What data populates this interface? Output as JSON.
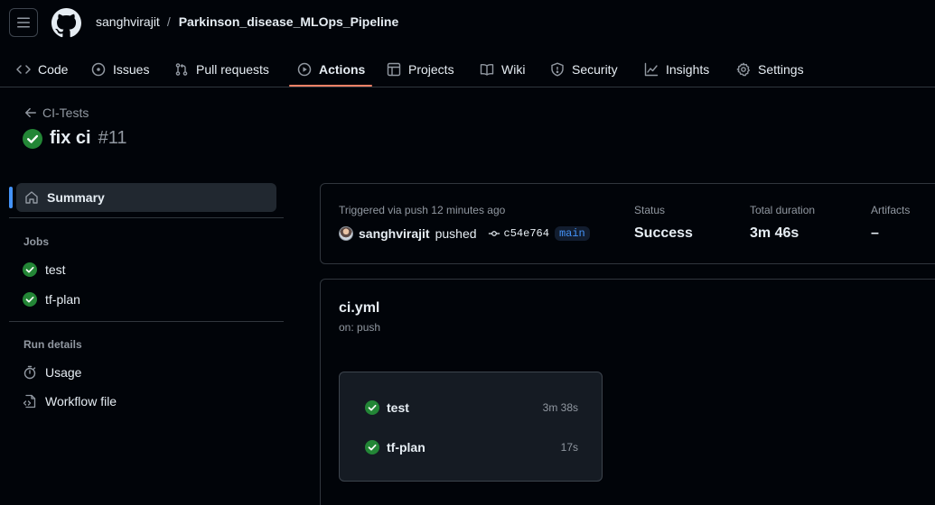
{
  "header": {
    "owner": "sanghvirajit",
    "separator": "/",
    "repo": "Parkinson_disease_MLOps_Pipeline"
  },
  "tabs": [
    {
      "label": "Code",
      "icon": "code-icon"
    },
    {
      "label": "Issues",
      "icon": "issue-icon"
    },
    {
      "label": "Pull requests",
      "icon": "pull-request-icon"
    },
    {
      "label": "Actions",
      "icon": "play-icon",
      "active": true
    },
    {
      "label": "Projects",
      "icon": "table-icon"
    },
    {
      "label": "Wiki",
      "icon": "book-icon"
    },
    {
      "label": "Security",
      "icon": "shield-icon"
    },
    {
      "label": "Insights",
      "icon": "graph-icon"
    },
    {
      "label": "Settings",
      "icon": "gear-icon"
    }
  ],
  "run": {
    "back_label": "CI-Tests",
    "title": "fix ci",
    "number": "#11"
  },
  "sidebar": {
    "summary_label": "Summary",
    "jobs_heading": "Jobs",
    "jobs": [
      {
        "label": "test",
        "status": "success"
      },
      {
        "label": "tf-plan",
        "status": "success"
      }
    ],
    "run_details_heading": "Run details",
    "details": [
      {
        "label": "Usage",
        "icon": "stopwatch-icon"
      },
      {
        "label": "Workflow file",
        "icon": "file-code-icon"
      }
    ]
  },
  "summary": {
    "trigger_text": "Triggered via push 12 minutes ago",
    "actor": "sanghvirajit",
    "action": "pushed",
    "commit": "c54e764",
    "branch": "main",
    "status_label": "Status",
    "status_value": "Success",
    "duration_label": "Total duration",
    "duration_value": "3m 46s",
    "artifacts_label": "Artifacts",
    "artifacts_value": "–"
  },
  "workflow": {
    "file": "ci.yml",
    "trigger": "on: push",
    "jobs": [
      {
        "name": "test",
        "duration": "3m 38s",
        "status": "success"
      },
      {
        "name": "tf-plan",
        "duration": "17s",
        "status": "success"
      }
    ]
  },
  "colors": {
    "background": "#010409",
    "accent_underline": "#f78166",
    "success": "#238636",
    "link_blue": "#4493f8",
    "muted_text": "#9198a1",
    "border": "#30363d"
  }
}
